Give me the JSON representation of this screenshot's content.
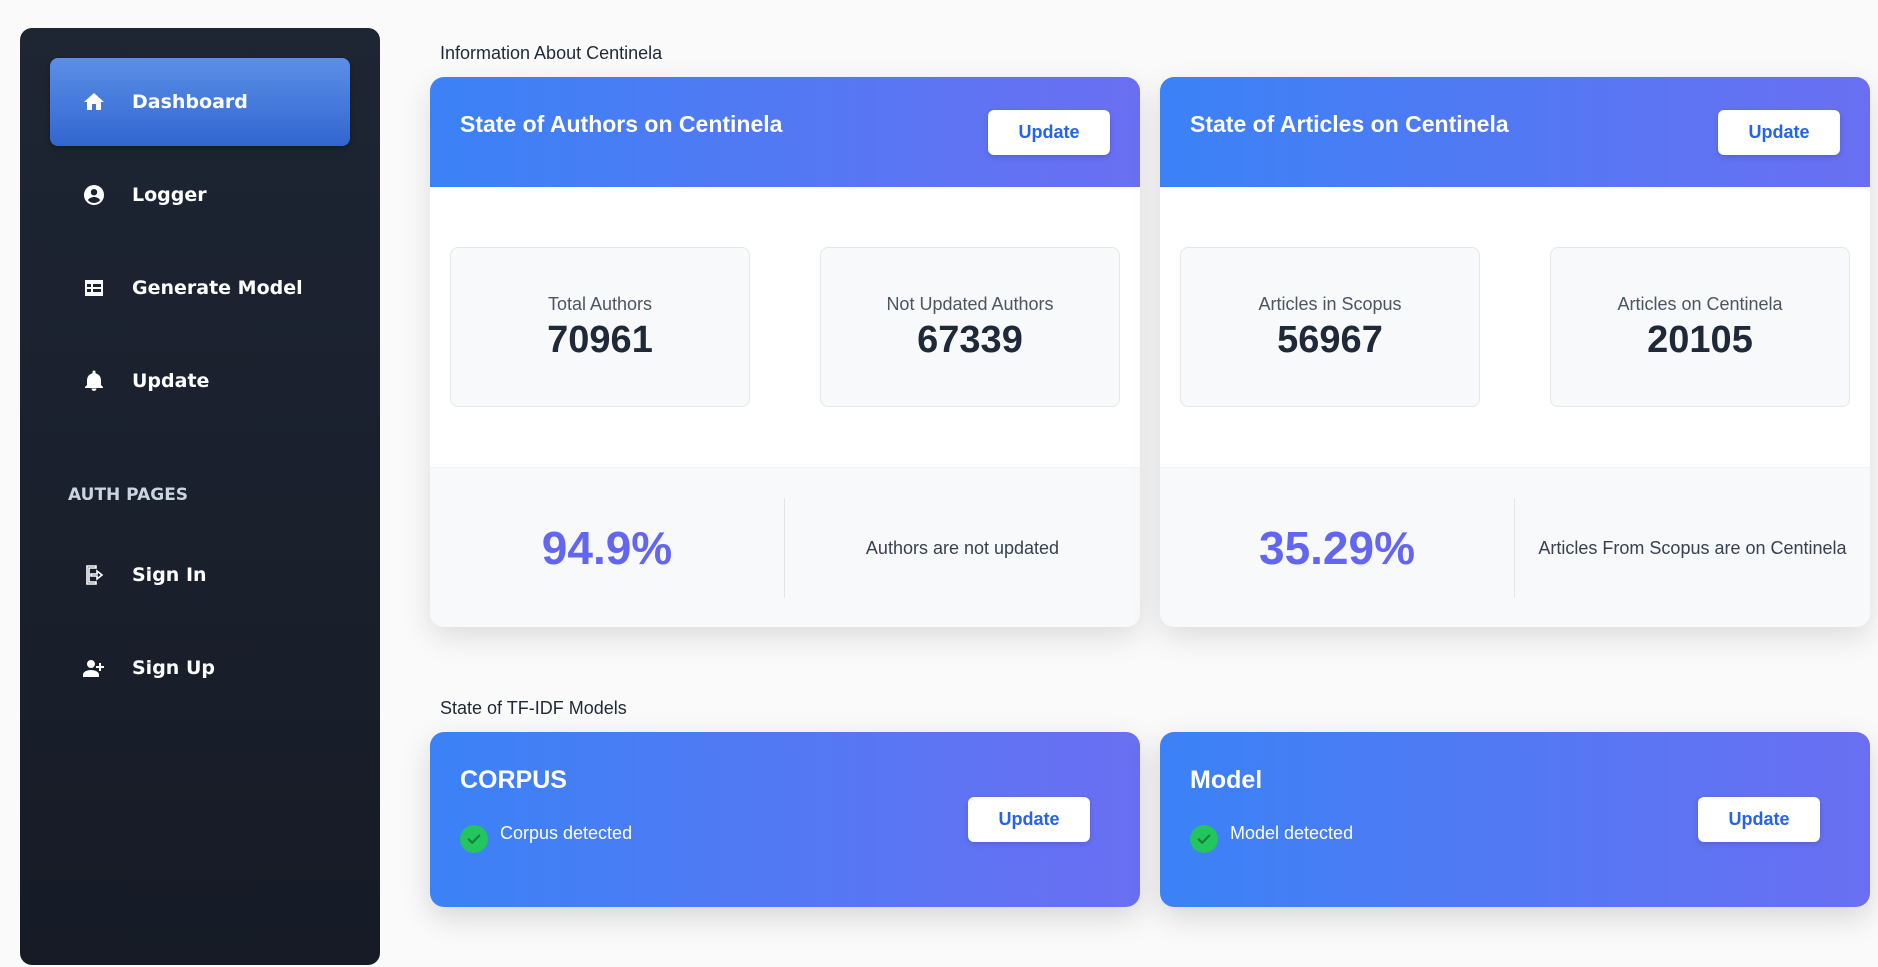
{
  "sidebar": {
    "items": [
      {
        "label": "Dashboard",
        "icon": "home-icon"
      },
      {
        "label": "Logger",
        "icon": "user-circle-icon"
      },
      {
        "label": "Generate Model",
        "icon": "table-icon"
      },
      {
        "label": "Update",
        "icon": "bell-icon"
      }
    ],
    "auth_section_label": "AUTH PAGES",
    "auth_items": [
      {
        "label": "Sign In",
        "icon": "sign-in-icon"
      },
      {
        "label": "Sign Up",
        "icon": "user-plus-icon"
      }
    ],
    "active_item": "Dashboard"
  },
  "info_section": {
    "title": "Information About Centinela",
    "authors_card": {
      "title": "State of Authors on Centinela",
      "button": "Update",
      "stats": [
        {
          "label": "Total Authors",
          "value": "70961"
        },
        {
          "label": "Not Updated Authors",
          "value": "67339"
        }
      ],
      "percentage": "94.9%",
      "summary": "Authors are not updated"
    },
    "articles_card": {
      "title": "State of Articles on Centinela",
      "button": "Update",
      "stats": [
        {
          "label": "Articles in Scopus",
          "value": "56967"
        },
        {
          "label": "Articles on Centinela",
          "value": "20105"
        }
      ],
      "percentage": "35.29%",
      "summary": "Articles From Scopus are on Centinela"
    }
  },
  "models_section": {
    "title": "State of TF-IDF Models",
    "corpus_card": {
      "title": "CORPUS",
      "status": "Corpus detected",
      "button": "Update"
    },
    "model_card": {
      "title": "Model",
      "status": "Model detected",
      "button": "Update"
    }
  },
  "colors": {
    "accent_start": "#3b82f6",
    "accent_end": "#6a6ff2",
    "percentage": "#6366f1",
    "sidebar_bg": "#1e2533",
    "success": "#22c55e"
  }
}
